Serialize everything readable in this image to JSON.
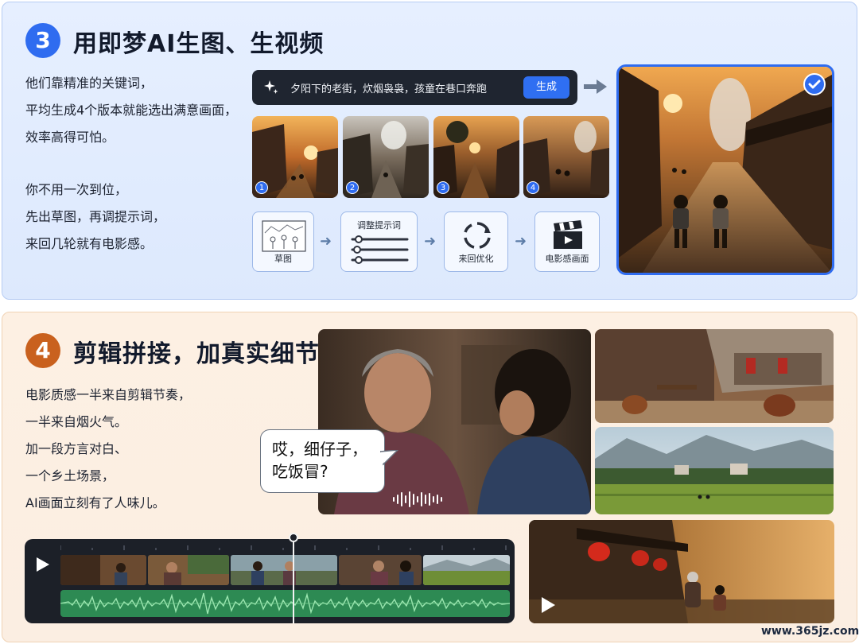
{
  "section3": {
    "number": "3",
    "title": "用即梦AI生图、生视频",
    "paragraph1": [
      "他们靠精准的关键词，",
      "平均生成4个版本就能选出满意画面，",
      "效率高得可怕。"
    ],
    "paragraph2": [
      "你不用一次到位，",
      "先出草图，再调提示词，",
      "来回几轮就有电影感。"
    ],
    "prompt_text": "夕阳下的老街，炊烟袅袅，孩童在巷口奔跑",
    "generate_label": "生成",
    "thumbnails": [
      "1",
      "2",
      "3",
      "4"
    ],
    "steps": {
      "sketch": "草图",
      "adjust": "调整提示词",
      "iterate": "来回优化",
      "cinematic": "电影感画面"
    }
  },
  "section4": {
    "number": "4",
    "title": "剪辑拼接，加真实细节",
    "paragraph": [
      "电影质感一半来自剪辑节奏，",
      "一半来自烟火气。",
      "加一段方言对白、",
      "一个乡土场景，",
      "AI画面立刻有了人味儿。"
    ],
    "dialogue": [
      "哎，细仔子，",
      "吃饭冒?"
    ]
  },
  "watermark": "www.365jz.com",
  "colors": {
    "accent_blue": "#2f6cf0",
    "accent_orange": "#c9611e",
    "timeline_bg": "#1c2028",
    "waveform": "#2d8a53"
  }
}
